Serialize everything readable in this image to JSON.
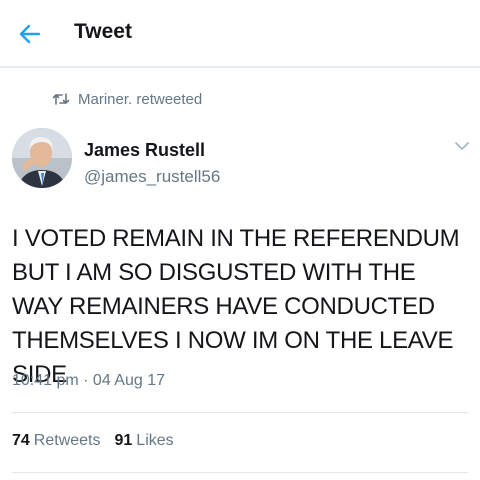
{
  "header": {
    "title": "Tweet"
  },
  "colors": {
    "accent": "#1da1f2",
    "secondary_text": "#657786",
    "divider": "#e1e8ed"
  },
  "retweet_context": {
    "text": "Mariner. retweeted",
    "icon": "retweet-icon"
  },
  "tweet": {
    "author_name": "James Rustell",
    "author_handle": "@james_rustell56",
    "text": "I VOTED REMAIN IN THE REFERENDUM BUT I AM SO DISGUSTED WITH THE WAY REMAINERS HAVE CONDUCTED THEMSELVES I NOW IM ON THE LEAVE SIDE",
    "timestamp": "10:41 pm · 04 Aug 17"
  },
  "stats": {
    "retweets_count": "74",
    "retweets_label": "Retweets",
    "likes_count": "91",
    "likes_label": "Likes"
  }
}
